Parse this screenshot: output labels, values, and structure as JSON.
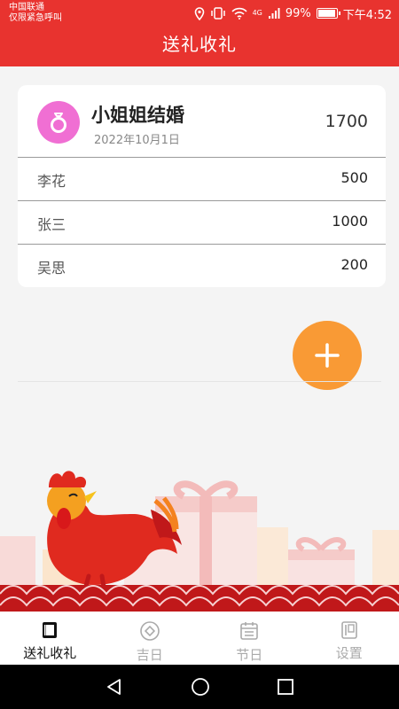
{
  "status_bar": {
    "carrier_line1": "中国联通",
    "carrier_line2": "仅限紧急呼叫",
    "battery": "99%",
    "battery_level": 0.99,
    "time": "下午4:52",
    "signal_label": "4G"
  },
  "header": {
    "title": "送礼收礼"
  },
  "event": {
    "icon": "ring-icon",
    "title": "小姐姐结婚",
    "date": "2022年10月1日",
    "total": "1700",
    "gifts": [
      {
        "name": "李花",
        "amount": "500"
      },
      {
        "name": "张三",
        "amount": "1000"
      },
      {
        "name": "吴思",
        "amount": "200"
      }
    ]
  },
  "fab": {
    "icon": "plus-icon"
  },
  "bottom_nav": [
    {
      "label": "送礼收礼",
      "icon": "ledger-icon",
      "active": true
    },
    {
      "label": "吉日",
      "icon": "coin-icon",
      "active": false
    },
    {
      "label": "节日",
      "icon": "calendar-icon",
      "active": false
    },
    {
      "label": "设置",
      "icon": "settings-book-icon",
      "active": false
    }
  ],
  "colors": {
    "header": "#e8332f",
    "fab": "#f99a35",
    "ring_badge": "#f06fd3"
  }
}
